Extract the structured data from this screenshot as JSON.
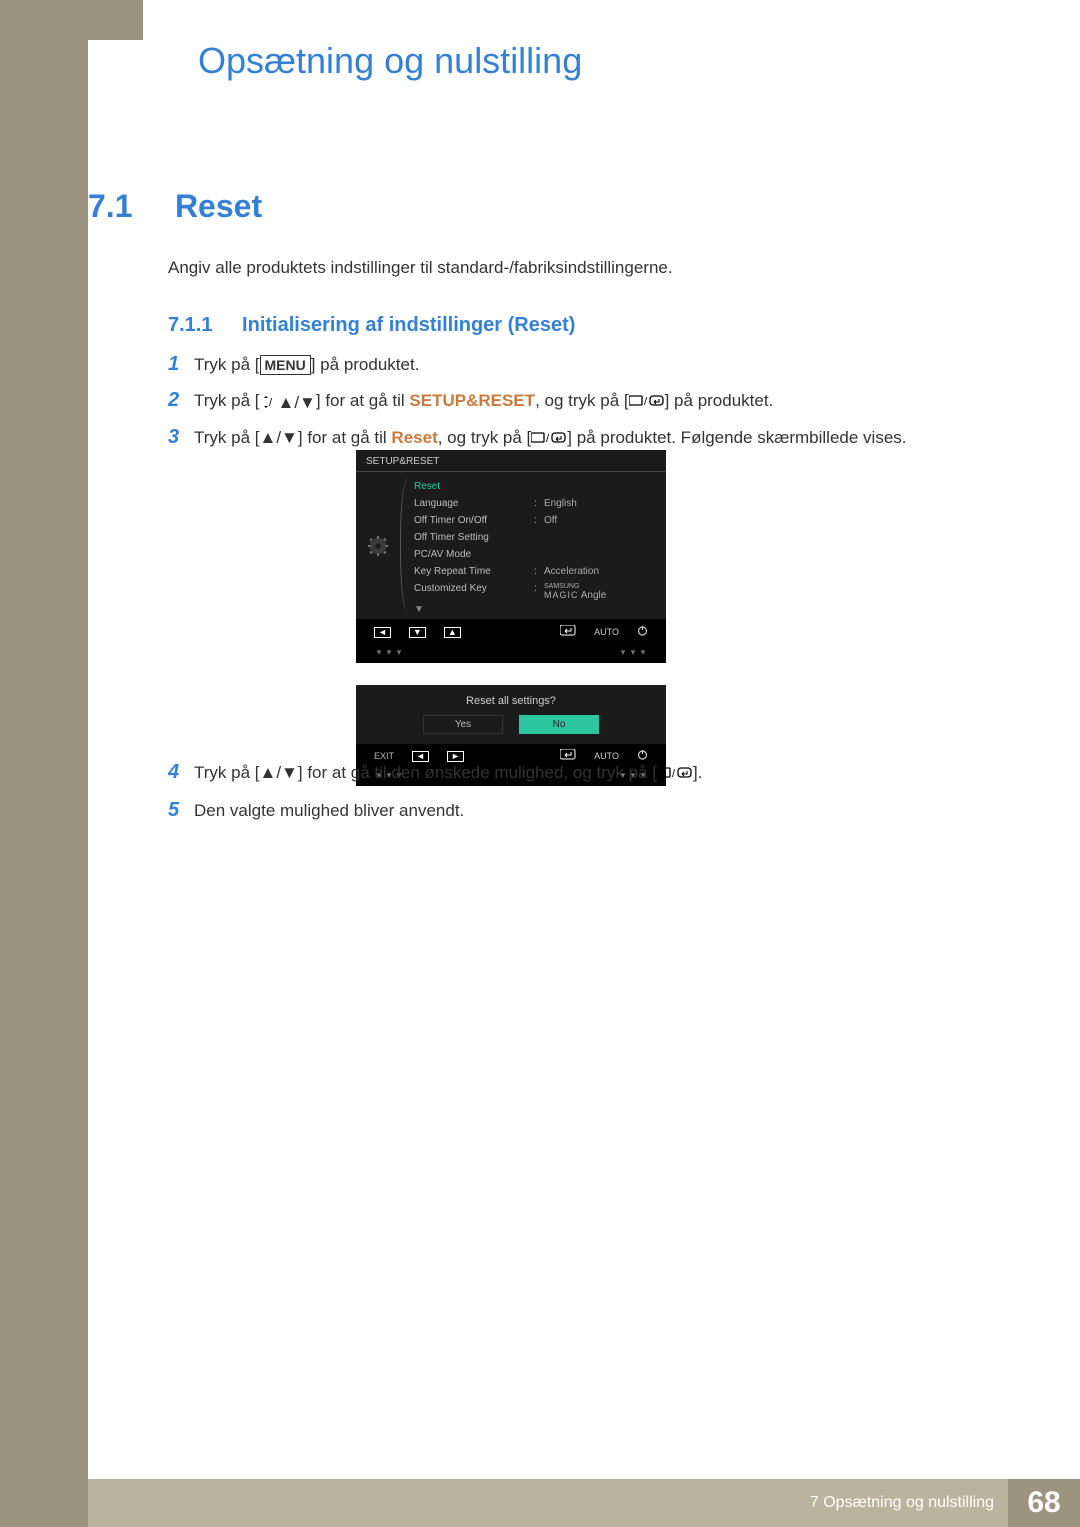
{
  "chapter_title": "Opsætning og nulstilling",
  "section": {
    "num": "7.1",
    "title": "Reset"
  },
  "section_desc": "Angiv alle produktets indstillinger til standard-/fabriksindstillingerne.",
  "subsection": {
    "num": "7.1.1",
    "title": "Initialisering af indstillinger (Reset)"
  },
  "steps": {
    "s1": {
      "num": "1",
      "pre": "Tryk på [",
      "menu": "MENU",
      "post": "] på produktet."
    },
    "s2": {
      "num": "2",
      "pre": "Tryk på [",
      "mid": "] for at gå til ",
      "hl": "SETUP&RESET",
      "after": ", og tryk på [",
      "post": "] på produktet."
    },
    "s3": {
      "num": "3",
      "pre": "Tryk på [",
      "mid": "] for at gå til ",
      "hl": "Reset",
      "after": ", og tryk på [",
      "post": "] på produktet. Følgende skærmbillede vises."
    },
    "s4": {
      "num": "4",
      "pre": "Tryk på [",
      "mid": "] for at gå til den ønskede mulighed, og tryk på [",
      "post": "]."
    },
    "s5": {
      "num": "5",
      "txt": "Den valgte mulighed bliver anvendt."
    }
  },
  "osd": {
    "title": "SETUP&RESET",
    "rows": [
      {
        "lab": "Reset",
        "val": "",
        "sel": true
      },
      {
        "lab": "Language",
        "val": "English"
      },
      {
        "lab": "Off Timer On/Off",
        "val": "Off"
      },
      {
        "lab": "Off Timer Setting",
        "val": ""
      },
      {
        "lab": "PC/AV Mode",
        "val": ""
      },
      {
        "lab": "Key Repeat Time",
        "val": "Acceleration"
      },
      {
        "lab": "Customized Key",
        "val_html": true
      }
    ],
    "magic_top": "SAMSUNG",
    "magic_bot": "MAGIC",
    "magic_suffix": " Angle",
    "bottom": {
      "auto": "AUTO"
    }
  },
  "osd2": {
    "q": "Reset all settings?",
    "yes": "Yes",
    "no": "No",
    "exit": "EXIT",
    "auto": "AUTO"
  },
  "footer": {
    "text": "7 Opsætning og nulstilling",
    "page": "68"
  }
}
